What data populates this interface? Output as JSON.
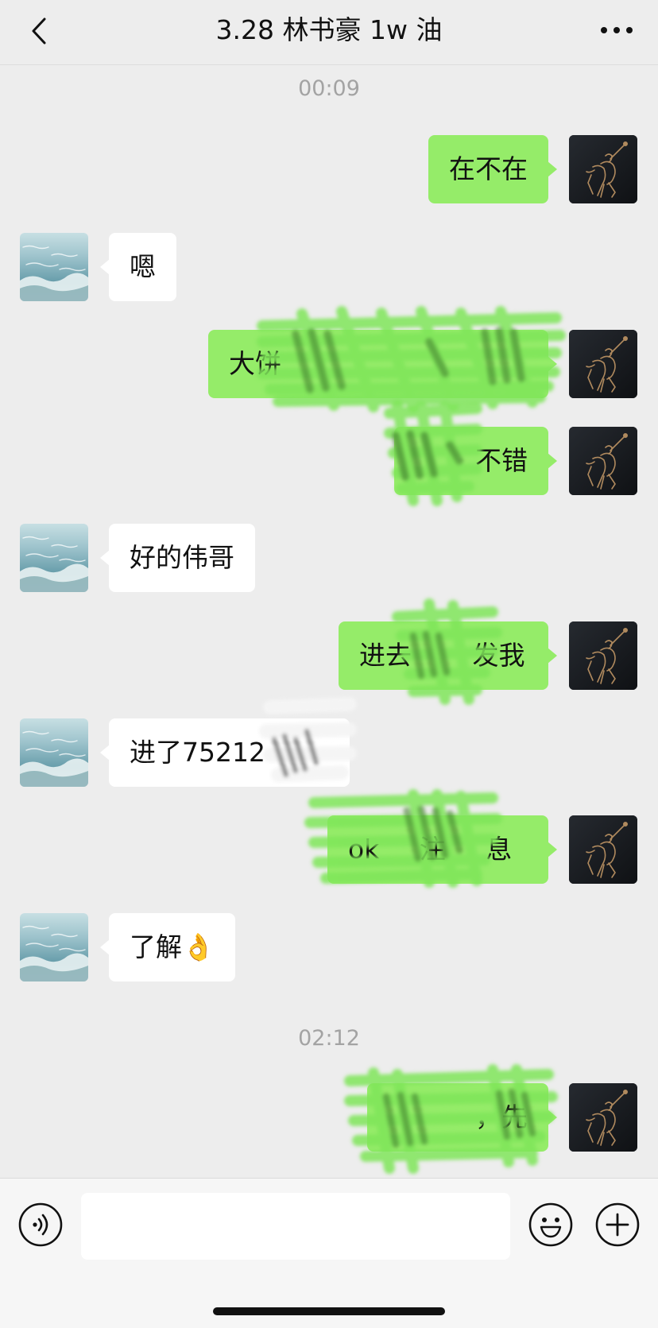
{
  "header": {
    "title": "3.28 林书豪 1w 油"
  },
  "times": [
    "00:09",
    "02:12"
  ],
  "messages": [
    {
      "side": "me",
      "text": "在不在"
    },
    {
      "side": "them",
      "text": "嗯"
    },
    {
      "side": "me",
      "text": "大饼"
    },
    {
      "side": "me",
      "text": "不错"
    },
    {
      "side": "them",
      "text": "好的伟哥"
    },
    {
      "side": "me",
      "text": "进去 发我"
    },
    {
      "side": "them",
      "text": "进了75212"
    },
    {
      "side": "me",
      "text": "ok 注 息"
    },
    {
      "side": "them",
      "text": "了解👌"
    },
    {
      "side": "me",
      "text": "，先"
    }
  ],
  "icons": {
    "back": "chevron-left-icon",
    "more": "more-dots-icon",
    "voice": "voice-icon",
    "emoji": "emoji-icon",
    "add": "plus-icon"
  },
  "colors": {
    "my_bubble": "#95ec69",
    "their_bubble": "#ffffff",
    "background": "#ededed"
  }
}
